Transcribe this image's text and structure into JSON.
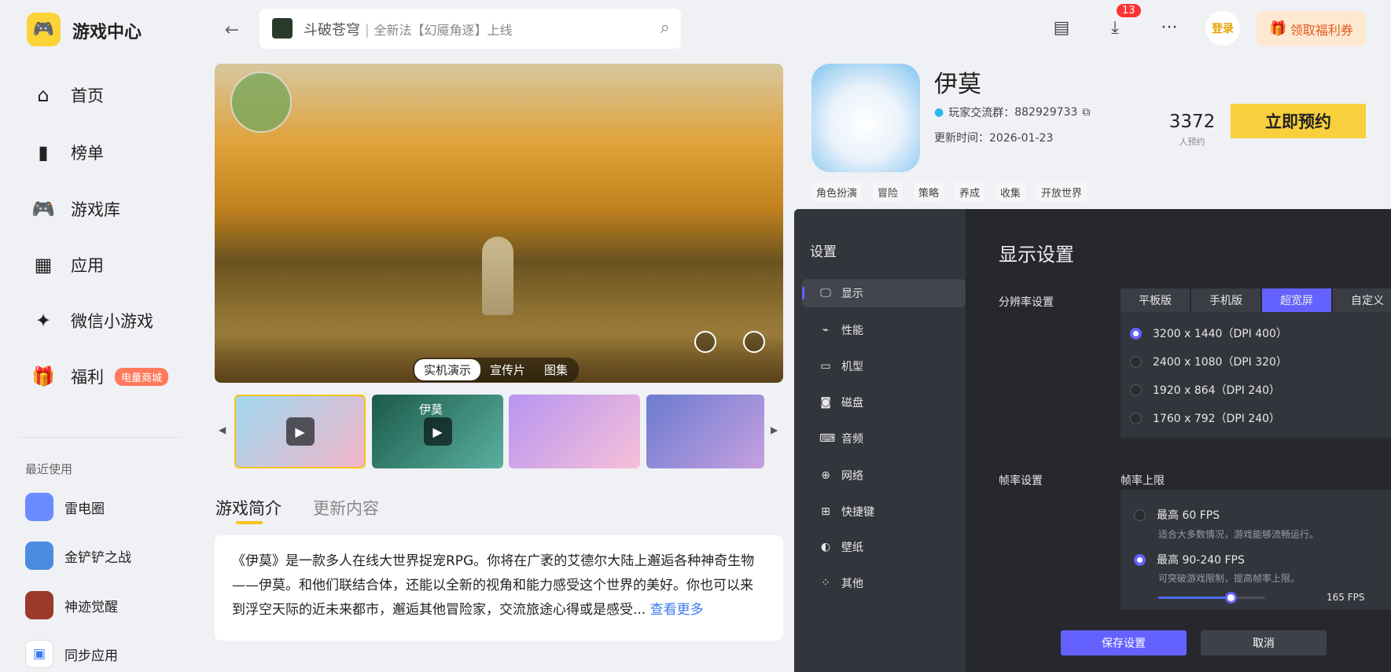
{
  "app": {
    "name": "游戏中心"
  },
  "sidebar": {
    "items": [
      {
        "label": "首页",
        "icon": "home-icon"
      },
      {
        "label": "榜单",
        "icon": "ranking-icon"
      },
      {
        "label": "游戏库",
        "icon": "gamepad-icon"
      },
      {
        "label": "应用",
        "icon": "apps-icon"
      },
      {
        "label": "微信小游戏",
        "icon": "wechat-minigame-icon"
      },
      {
        "label": "福利",
        "icon": "gift-icon",
        "badge": "电量商城"
      }
    ],
    "recent_label": "最近使用",
    "recent": [
      {
        "label": "雷电圈",
        "color": "#6b8cff"
      },
      {
        "label": "金铲铲之战",
        "color": "#4a8de0"
      },
      {
        "label": "神迹觉醒",
        "color": "#9b3a2a"
      },
      {
        "label": "同步应用",
        "color": "#3d7bf0"
      }
    ]
  },
  "header": {
    "search_game": "斗破苍穹",
    "search_text": "全新法【幻魇角逐】上线",
    "download_count": "13",
    "login": "登录",
    "welfare": "领取福利券"
  },
  "game": {
    "title": "伊莫",
    "group_label": "玩家交流群：",
    "group_id": "882929733",
    "update_label": "更新时间：",
    "update_date": "2026-01-23",
    "reserve_count": "3372",
    "reserve_count_label": "人预约",
    "reserve_button": "立即预约",
    "tags": [
      "角色扮演",
      "冒险",
      "策略",
      "养成",
      "收集",
      "开放世界"
    ]
  },
  "media": {
    "tabs": [
      "实机演示",
      "宣传片",
      "图集"
    ],
    "active_tab": 0,
    "thumb_title": "伊莫"
  },
  "info": {
    "tabs": [
      "游戏简介",
      "更新内容"
    ],
    "description": "《伊莫》是一款多人在线大世界捉宠RPG。你将在广袤的艾德尔大陆上邂逅各种神奇生物——伊莫。和他们联结合体，还能以全新的视角和能力感受这个世界的美好。你也可以来到浮空天际的近未来都市，邂逅其他冒险家，交流旅途心得或是感受...",
    "more": "查看更多"
  },
  "settings": {
    "title": "设置",
    "menu": [
      {
        "label": "显示",
        "icon": "monitor-icon"
      },
      {
        "label": "性能",
        "icon": "performance-icon"
      },
      {
        "label": "机型",
        "icon": "device-icon"
      },
      {
        "label": "磁盘",
        "icon": "disk-icon"
      },
      {
        "label": "音频",
        "icon": "audio-icon"
      },
      {
        "label": "网络",
        "icon": "globe-icon"
      },
      {
        "label": "快捷键",
        "icon": "keyboard-icon"
      },
      {
        "label": "壁纸",
        "icon": "palette-icon"
      },
      {
        "label": "其他",
        "icon": "grid-icon"
      }
    ],
    "section_title": "显示设置",
    "resolution_label": "分辨率设置",
    "resolution_tabs": [
      "平板版",
      "手机版",
      "超宽屏",
      "自定义"
    ],
    "resolutions": [
      "3200 x 1440（DPI 400）",
      "2400 x 1080（DPI 320）",
      "1920 x 864（DPI 240）",
      "1760 x 792（DPI 240）"
    ],
    "fps_label": "帧率设置",
    "fps_limit_label": "帧率上限",
    "fps_options": [
      {
        "title": "最高 60 FPS",
        "desc": "适合大多数情况，游戏能够流畅运行。"
      },
      {
        "title": "最高 90-240 FPS",
        "desc": "可突破游戏限制，提高帧率上限。"
      }
    ],
    "fps_value": "165 FPS",
    "fps_slider_percent": 68,
    "save": "保存设置",
    "cancel": "取消",
    "accent": "#6362ff"
  }
}
